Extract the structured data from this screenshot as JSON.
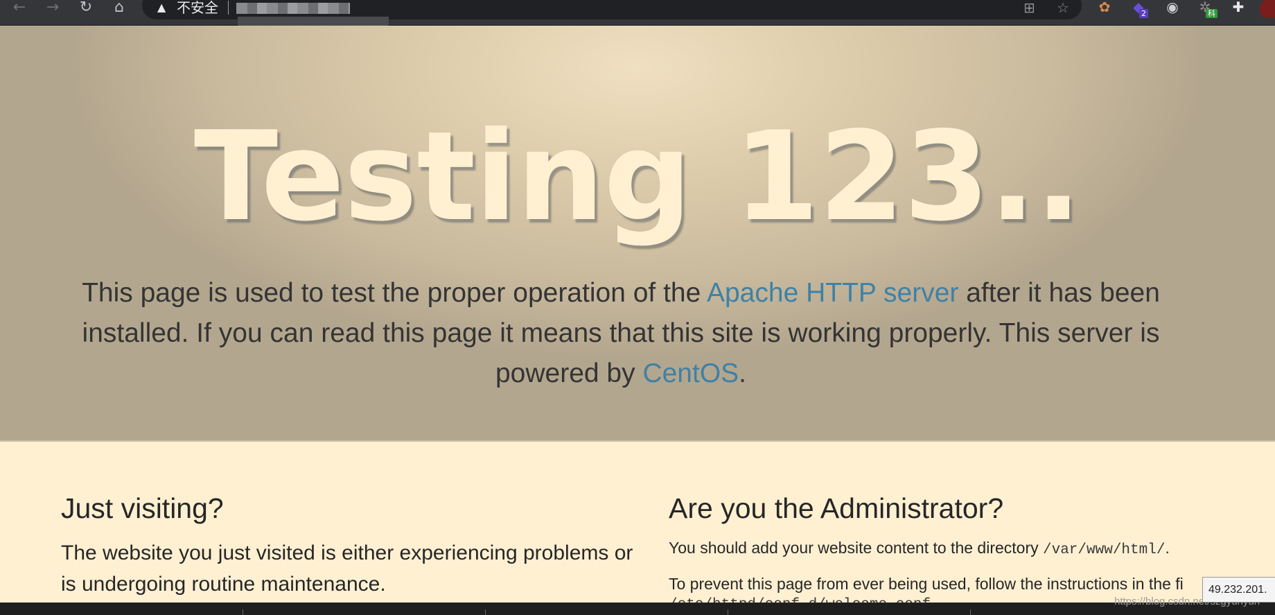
{
  "browser": {
    "security_label": "不安全",
    "extension_badges": {
      "ext2": "2",
      "ext4": "科"
    },
    "icons": [
      "back-icon",
      "forward-icon",
      "reload-icon",
      "home-icon",
      "warning-icon",
      "translate-icon",
      "star-icon",
      "puzzle-icon"
    ]
  },
  "hero": {
    "title": "Testing 123..",
    "text_before_link1": "This page is used to test the proper operation of the ",
    "link1": "Apache HTTP server",
    "text_between": " after it has been installed. If you can read this page it means that this site is working properly. This server is powered by ",
    "link2": "CentOS",
    "text_after": "."
  },
  "left": {
    "heading": "Just visiting?",
    "body": "The website you just visited is either experiencing problems or is undergoing routine maintenance."
  },
  "right": {
    "heading": "Are you the Administrator?",
    "body_before_path": "You should add your website content to the directory ",
    "path": "/var/www/html/",
    "body_after_path": ".",
    "body2": "To prevent this page from ever being used, follow the instructions in the fi",
    "body3": "/etc/httpd/conf.d/welcome.conf"
  },
  "overlay": {
    "ip_tooltip": "49.232.201.",
    "watermark": "https://blog.csdn.net/szgyunyun"
  },
  "colors": {
    "chrome": "#35363a",
    "hero_text": "#343434",
    "link": "#3f81a5",
    "title": "#fff0d2",
    "page_bg": "#fff0d2"
  }
}
